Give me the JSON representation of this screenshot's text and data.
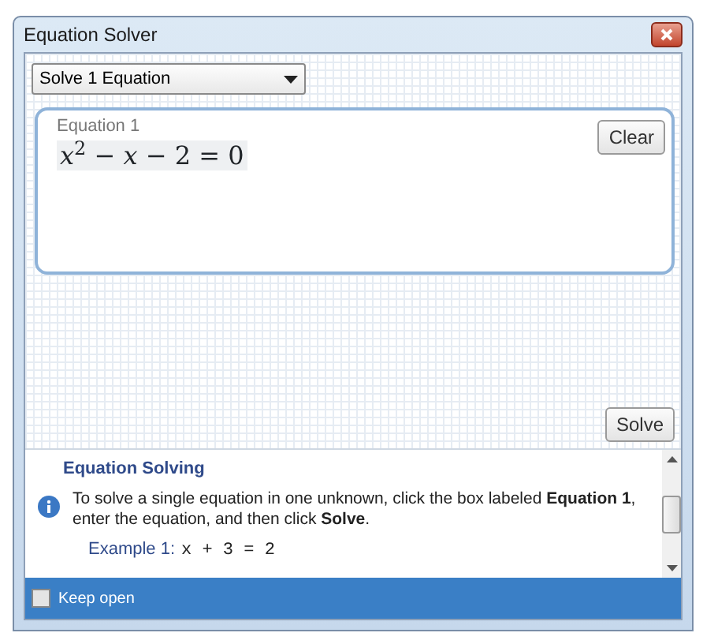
{
  "window": {
    "title": "Equation Solver"
  },
  "mode_select": {
    "value": "Solve 1 Equation"
  },
  "equation": {
    "label": "Equation 1",
    "value": "*x*$^{2}$ − *x* − 2 = 0",
    "clear_button": "Clear"
  },
  "solve_button": "Solve",
  "help": {
    "title": "Equation Solving",
    "text": "To solve a single equation in one unknown, click the box labeled **Equation 1**, enter the equation, and then click **Solve**.",
    "example_label": "Example 1:",
    "example_code": "x + 3 = 2"
  },
  "keep_open": {
    "label": "Keep open",
    "checked": false
  }
}
